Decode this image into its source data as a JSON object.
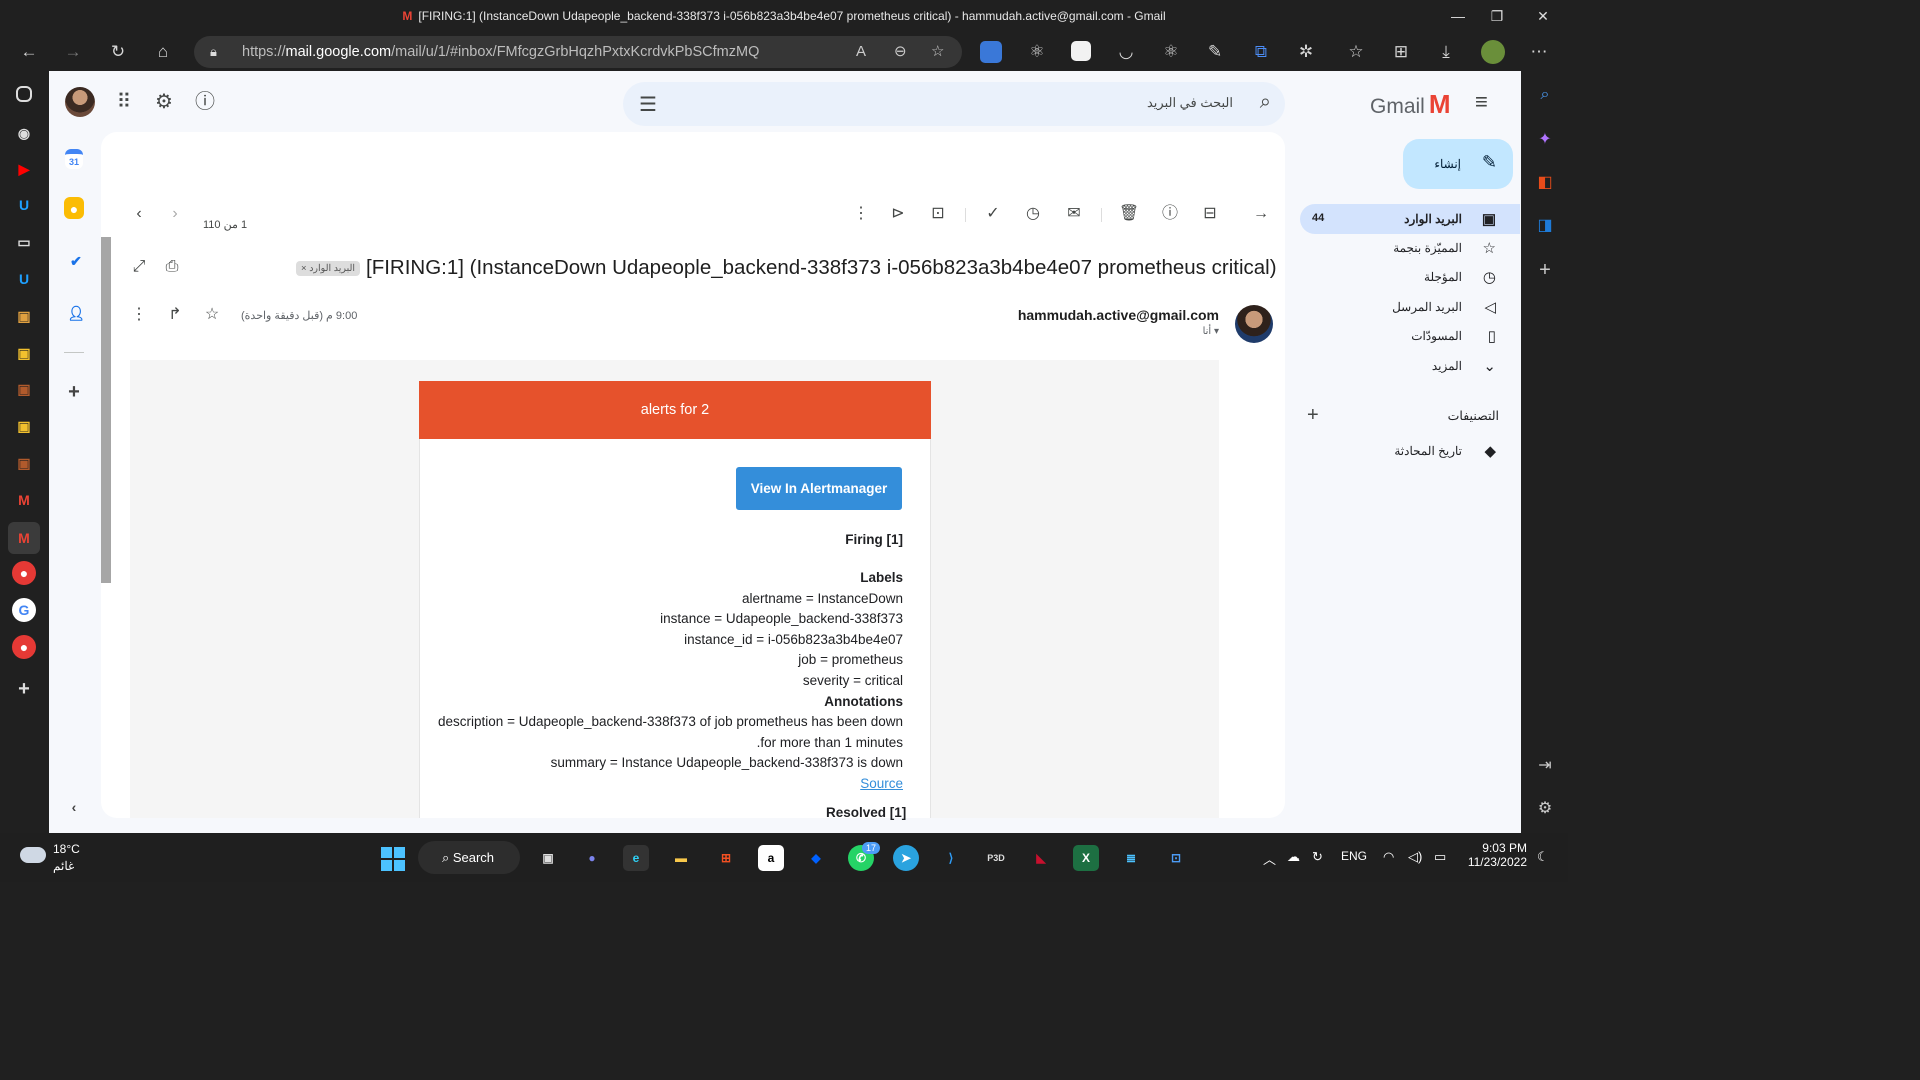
{
  "window": {
    "title": "[FIRING:1] (InstanceDown Udapeople_backend-338f373 i-056b823a3b4be4e07 prometheus critical) - hammudah.active@gmail.com - Gmail"
  },
  "browser": {
    "url_prefix": "https://",
    "url_host": "mail.google.com",
    "url_path": "/mail/u/1/#inbox/FMfcgzGrbHqzhPxtxKcrdvkPbSCfmzMQ"
  },
  "gmail": {
    "brand": "Gmail",
    "search_placeholder": "البحث في البريد",
    "compose_label": "إنشاء",
    "nav": [
      {
        "label": "البريد الوارد",
        "count": "44",
        "icon": "inbox-icon"
      },
      {
        "label": "المميّزة بنجمة",
        "count": "",
        "icon": "star-icon"
      },
      {
        "label": "المؤجلة",
        "count": "",
        "icon": "clock-icon"
      },
      {
        "label": "البريد المرسل",
        "count": "",
        "icon": "send-icon"
      },
      {
        "label": "المسودّات",
        "count": "",
        "icon": "draft-icon"
      },
      {
        "label": "المزيد",
        "count": "",
        "icon": "chevron-down-icon"
      }
    ],
    "labels_title": "التصنيفات",
    "labels": [
      {
        "label": "تاريخ المحادثة",
        "icon": "label-icon"
      }
    ]
  },
  "message": {
    "pager": "1 من 110",
    "subject": "[FIRING:1] (InstanceDown Udapeople_backend-338f373 i-056b823a3b4be4e07 prometheus critical)",
    "label_chip": "البريد الوارد",
    "label_chip_close": "×",
    "sender": "hammudah.active@gmail.com",
    "to": "أنا",
    "time": "9:00 م (قبل دقيقة واحدة)"
  },
  "alert": {
    "header": "alerts for 2",
    "header_color": "#e6522c",
    "button": "View In Alertmanager",
    "firing": "Firing [1]",
    "labels_title": "Labels",
    "labels": [
      "alertname = InstanceDown",
      "instance = Udapeople_backend-338f373",
      "instance_id = i-056b823a3b4be4e07",
      "job = prometheus",
      "severity = critical"
    ],
    "annotations_title": "Annotations",
    "description_line1": "description = Udapeople_backend-338f373 of job prometheus has been down",
    "description_line2": ".for more than 1 minutes",
    "summary": "summary = Instance Udapeople_backend-338f373 is down",
    "source": "Source",
    "resolved": "Resolved [1]"
  },
  "taskbar": {
    "temperature": "18°C",
    "condition": "غائم",
    "search": "Search",
    "language": "ENG",
    "time": "9:03 PM",
    "date": "11/23/2022",
    "whatsapp_badge": "17"
  }
}
